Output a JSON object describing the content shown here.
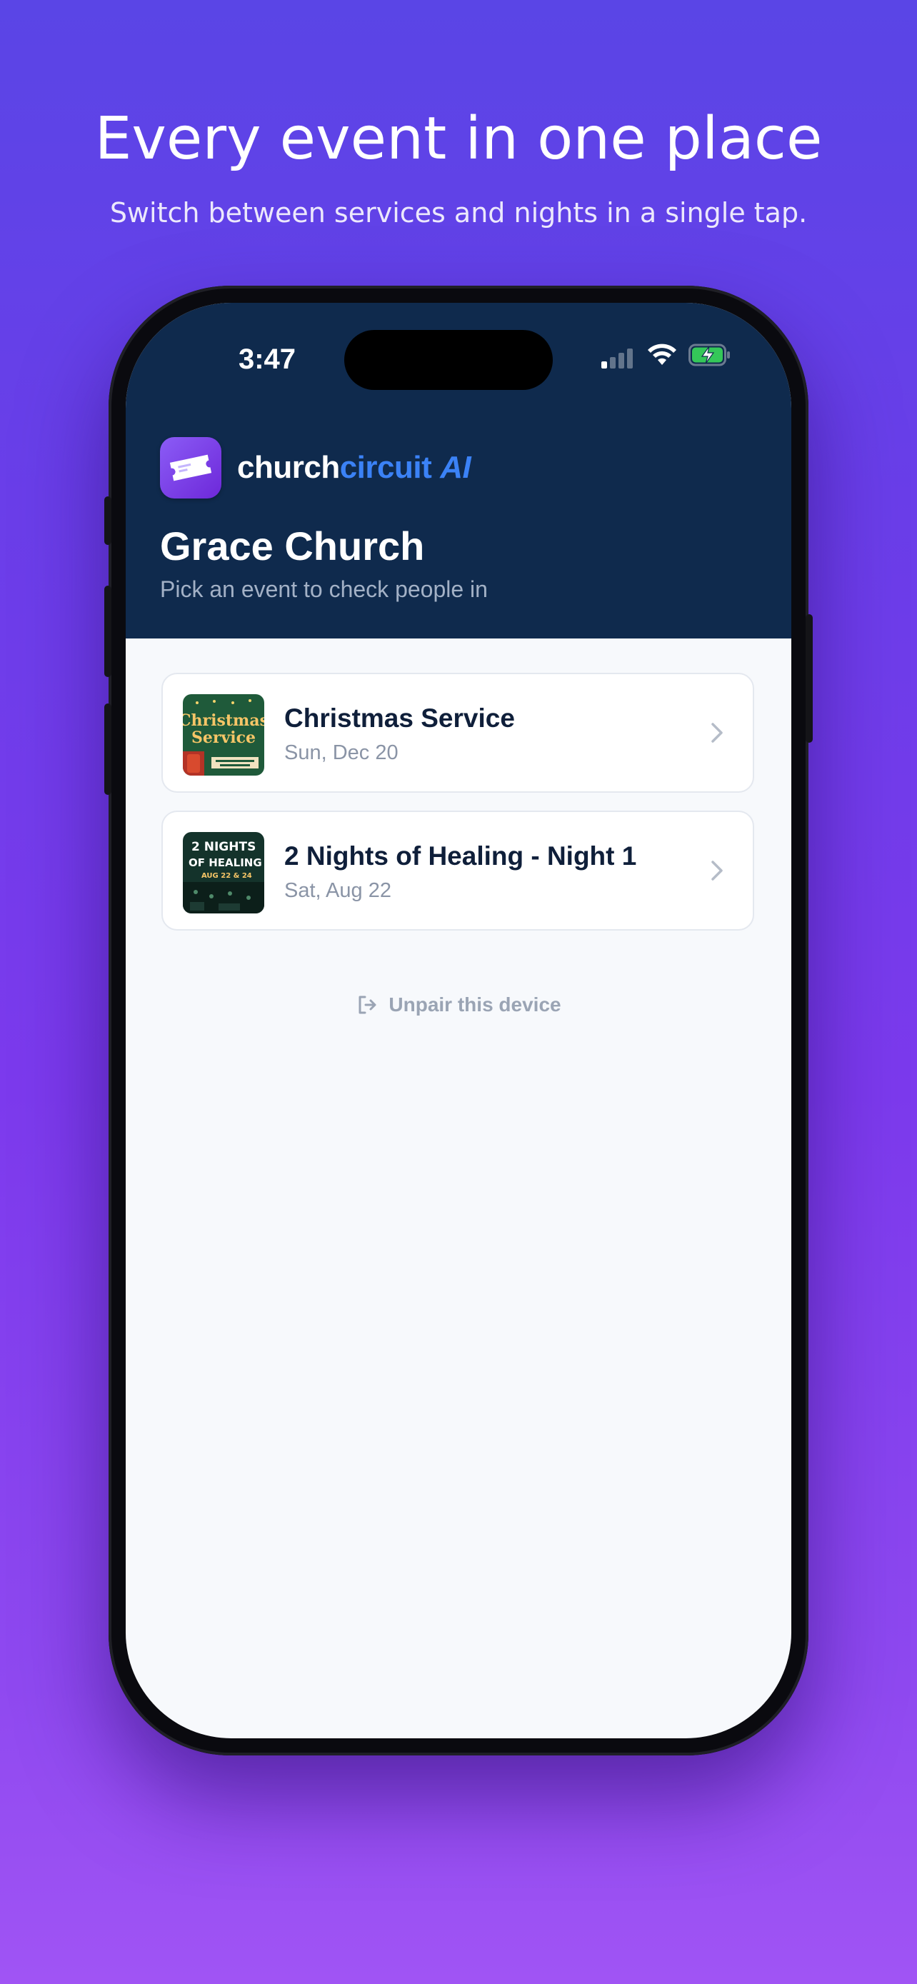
{
  "marketing": {
    "headline": "Every event in one place",
    "subheadline": "Switch between services and nights in a single tap."
  },
  "status_bar": {
    "time": "3:47",
    "icons": [
      "cellular-signal-icon",
      "wifi-icon",
      "battery-charging-icon"
    ]
  },
  "header": {
    "brand_part1": "church",
    "brand_part2": "circuit",
    "brand_part3": "AI",
    "org_name": "Grace Church",
    "subtitle": "Pick an event to check people in",
    "background_color": "#0f2a4d",
    "accent_color": "#3b82f6"
  },
  "events": [
    {
      "title": "Christmas Service",
      "date": "Sun, Dec 20",
      "thumbnail_text": [
        "Christmas",
        "Service"
      ]
    },
    {
      "title": "2 Nights of Healing - Night 1",
      "date": "Sat, Aug 22",
      "thumbnail_text": [
        "2 NIGHTS",
        "OF HEALING",
        "AUG 22 & 24"
      ]
    }
  ],
  "actions": {
    "unpair_label": "Unpair this device"
  }
}
